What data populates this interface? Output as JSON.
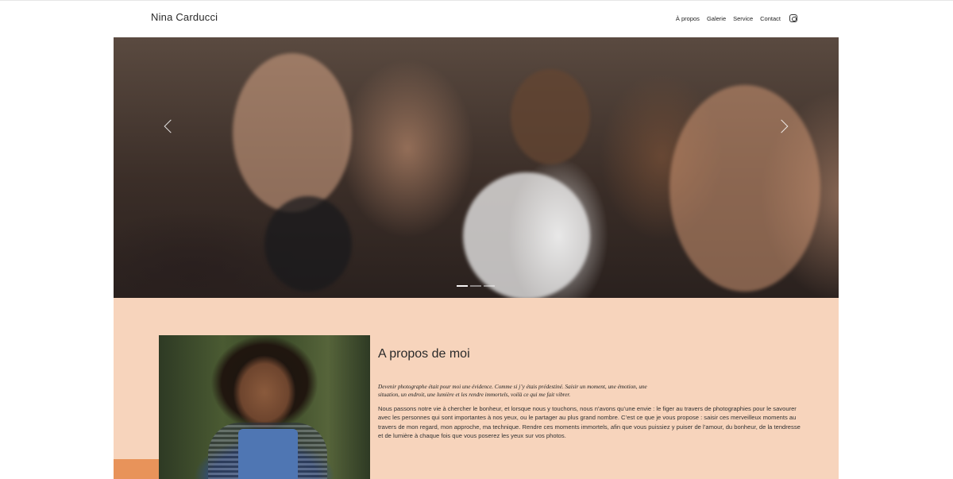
{
  "header": {
    "brand": "Nina Carducci",
    "nav": [
      {
        "label": "À propos"
      },
      {
        "label": "Galerie"
      },
      {
        "label": "Service"
      },
      {
        "label": "Contact"
      }
    ],
    "social_icon": "instagram-icon"
  },
  "hero": {
    "prev_icon": "chevron-left-icon",
    "next_icon": "chevron-right-icon",
    "slide_count": 3,
    "active_slide": 1
  },
  "about": {
    "title": "A propos de moi",
    "quote": "Devenir photographe était pour moi une évidence. Comme si j’y étais prédestiné. Saisir un moment, une émotion, une situation, un endroit, une lumière et les rendre immortels, voilà ce qui me fait vibrer.",
    "body": "Nous passons notre vie à chercher le bonheur, et lorsque nous y touchons, nous n’avons qu’une envie : le figer au travers de photographies pour le savourer avec les personnes qui sont importantes à nos yeux, ou le partager au plus grand nombre. C’est ce que je vous propose : saisir ces merveilleux moments au travers de mon regard, mon approche, ma technique. Rendre ces moments immortels, afin que vous puissiez y puiser de l’amour, du bonheur, de la tendresse et de lumière à chaque fois que vous poserez les yeux sur vos photos."
  },
  "colors": {
    "section_bg": "#f7d4bc",
    "accent": "#e8935a"
  }
}
